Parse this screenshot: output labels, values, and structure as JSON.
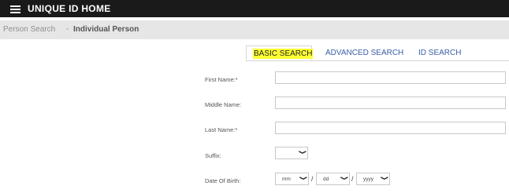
{
  "header": {
    "title": "UNIQUE ID HOME"
  },
  "breadcrumb": {
    "parent": "Person Search",
    "separator": "-",
    "current": "Individual Person"
  },
  "tabs": [
    {
      "label": "BASIC SEARCH",
      "active": true
    },
    {
      "label": "ADVANCED SEARCH",
      "active": false
    },
    {
      "label": "ID SEARCH",
      "active": false
    }
  ],
  "form": {
    "first_name_label": "First Name:*",
    "first_name_value": "",
    "middle_name_label": "Middle Name:",
    "middle_name_value": "",
    "last_name_label": "Last Name:*",
    "last_name_value": "",
    "suffix_label": "Suffix:",
    "suffix_value": "",
    "dob_label": "Date Of Birth:",
    "dob_month": "mm",
    "dob_day": "dd",
    "dob_year": "yyyy",
    "dob_sep": "/"
  },
  "colors": {
    "topbar": "#1a1a1a",
    "tab_text": "#3a5ea8",
    "highlight": "#ffff33"
  },
  "icons": {
    "menu": "hamburger-icon",
    "dropdown": "chevron-down-icon"
  }
}
